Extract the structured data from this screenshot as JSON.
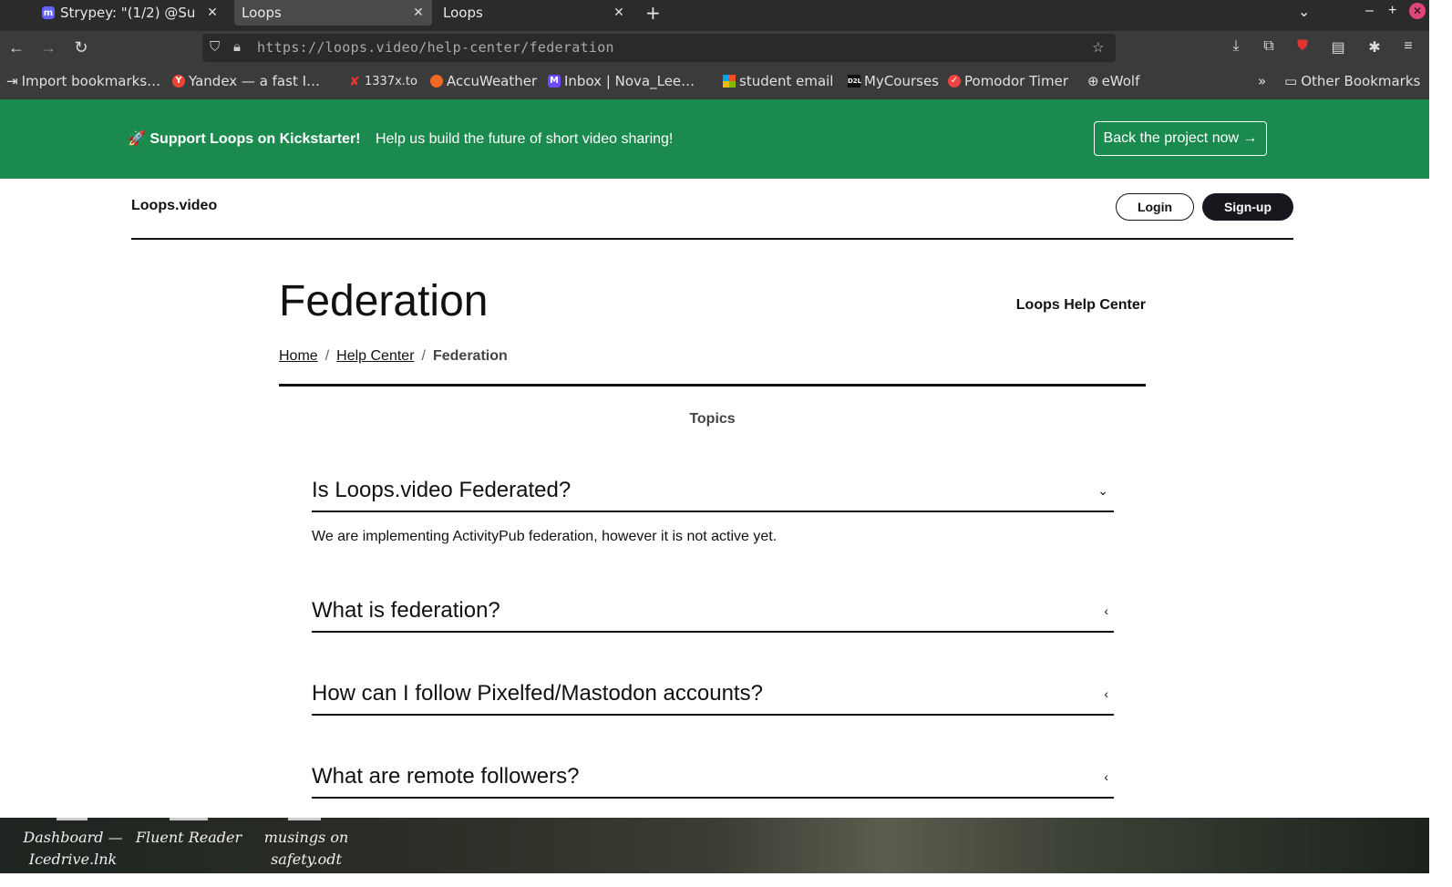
{
  "browser": {
    "tabs": [
      {
        "label": "Strypey: \"(1/2) @Su",
        "active": false
      },
      {
        "label": "Loops",
        "active": true
      },
      {
        "label": "Loops",
        "active": false
      }
    ],
    "new_tab": "+",
    "url": "https://loops.video/help-center/federation",
    "bookmarks": [
      {
        "label": "Import bookmarks…",
        "icon": "import-icon"
      },
      {
        "label": "Yandex — a fast I…",
        "icon": "yandex-icon"
      },
      {
        "label": "1337x.to",
        "icon": "1337x-icon"
      },
      {
        "label": "AccuWeather",
        "icon": "accuweather-icon"
      },
      {
        "label": "Inbox | Nova_Lee…",
        "icon": "proton-mail-icon"
      },
      {
        "label": "student email",
        "icon": "microsoft-icon"
      },
      {
        "label": "MyCourses",
        "icon": "d2l-icon"
      },
      {
        "label": "Pomodor Timer",
        "icon": "pomodoro-icon"
      },
      {
        "label": "eWolf",
        "icon": "globe-icon"
      }
    ],
    "other_bookmarks": "Other Bookmarks"
  },
  "banner": {
    "title": "🚀 Support Loops on Kickstarter!",
    "text": "Help us build the future of short video sharing!",
    "button": "Back the project now →",
    "bg_color": "#1b8a4f"
  },
  "header": {
    "logo": "Loops.video",
    "login": "Login",
    "signup": "Sign-up"
  },
  "page": {
    "title": "Federation",
    "help_center": "Loops Help Center",
    "breadcrumb": {
      "home": "Home",
      "sep": "/",
      "help_center": "Help Center",
      "current": "Federation"
    },
    "topics_label": "Topics",
    "faqs": [
      {
        "question": "Is Loops.video Federated?",
        "answer": "We are implementing ActivityPub federation, however it is not active yet.",
        "expanded": true,
        "chevron": "⌄"
      },
      {
        "question": "What is federation?",
        "expanded": false,
        "chevron": "‹"
      },
      {
        "question": "How can I follow Pixelfed/Mastodon accounts?",
        "expanded": false,
        "chevron": "‹"
      },
      {
        "question": "What are remote followers?",
        "expanded": false,
        "chevron": "‹"
      }
    ]
  },
  "taskbar": {
    "items": [
      {
        "label": "Dashboard —\nIcedrive.lnk"
      },
      {
        "label": "Fluent Reader"
      },
      {
        "label": "musings on\nsafety.odt"
      }
    ]
  }
}
